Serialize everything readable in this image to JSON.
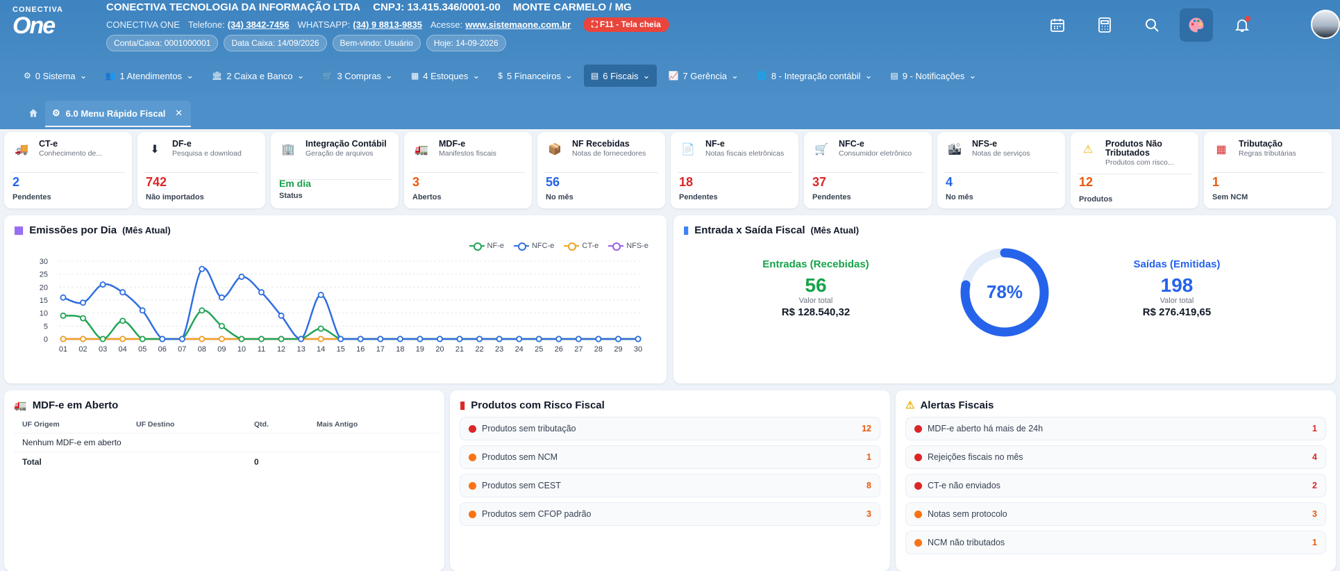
{
  "header": {
    "logo_small": "CONECTIVA",
    "logo_big": "One",
    "company": "CONECTIVA TECNOLOGIA DA INFORMAÇÃO LTDA",
    "cnpj": "CNPJ: 13.415.346/0001-00",
    "city": "MONTE CARMELO / MG",
    "brand": "CONECTIVA ONE",
    "phone_label": "Telefone:",
    "phone": "(34) 3842-7456",
    "whatsapp_label": "WHATSAPP:",
    "whatsapp": "(34) 9 8813-9835",
    "site_label": "Acesse:",
    "site": "www.sistemaone.com.br",
    "fullscreen": "⛶ F11 - Tela cheia",
    "pills": [
      "Conta/Caixa: 0001000001",
      "Data Caixa: 14/09/2026",
      "Bem-vindo: Usuário",
      "Hoje: 14-09-2026"
    ]
  },
  "menu": [
    {
      "icon": "⚙",
      "label": "0 Sistema"
    },
    {
      "icon": "👥",
      "label": "1 Atendimentos"
    },
    {
      "icon": "🏛",
      "label": "2 Caixa e Banco"
    },
    {
      "icon": "🛒",
      "label": "3 Compras"
    },
    {
      "icon": "▦",
      "label": "4 Estoques"
    },
    {
      "icon": "$",
      "label": "5 Financeiros"
    },
    {
      "icon": "▤",
      "label": "6 Fiscais"
    },
    {
      "icon": "📈",
      "label": "7 Gerência"
    },
    {
      "icon": "🌐",
      "label": "8 - Integração contábil"
    },
    {
      "icon": "▤",
      "label": "9 - Notificações"
    }
  ],
  "tab": {
    "label": "6.0 Menu Rápido Fiscal",
    "close": "✕"
  },
  "cards": [
    {
      "icon": "🚚",
      "title": "CT-e",
      "sub": "Conhecimento de...",
      "value": "2",
      "label": "Pendentes",
      "color": "#2563eb"
    },
    {
      "icon": "⬇",
      "title": "DF-e",
      "sub": "Pesquisa e download",
      "value": "742",
      "label": "Não importados",
      "color": "#dc2626"
    },
    {
      "icon": "🏢",
      "title": "Integração Contábil",
      "sub": "Geração de arquivos",
      "value": "Em dia",
      "label": "Status",
      "color": "#16a34a"
    },
    {
      "icon": "🚛",
      "title": "MDF-e",
      "sub": "Manifestos fiscais",
      "value": "3",
      "label": "Abertos",
      "color": "#ea580c"
    },
    {
      "icon": "📦",
      "title": "NF Recebidas",
      "sub": "Notas de fornecedores",
      "value": "56",
      "label": "No mês",
      "color": "#2563eb"
    },
    {
      "icon": "📄",
      "title": "NF-e",
      "sub": "Notas fiscais eletrônicas",
      "value": "18",
      "label": "Pendentes",
      "color": "#dc2626"
    },
    {
      "icon": "🛒",
      "title": "NFC-e",
      "sub": "Consumidor eletrônico",
      "value": "37",
      "label": "Pendentes",
      "color": "#dc2626"
    },
    {
      "icon": "🏙",
      "title": "NFS-e",
      "sub": "Notas de serviços",
      "value": "4",
      "label": "No mês",
      "color": "#2563eb"
    },
    {
      "icon": "⚠",
      "title": "Produtos Não Tributados",
      "sub": "Produtos com risco...",
      "value": "12",
      "label": "Produtos",
      "color": "#ea580c"
    },
    {
      "icon": "▦",
      "title": "Tributação",
      "sub": "Regras tributárias",
      "value": "1",
      "label": "Sem NCM",
      "color": "#ea580c"
    }
  ],
  "emissoes": {
    "title": "Emissões por Dia",
    "title_suffix": "(Mês Atual)"
  },
  "chart_data": {
    "type": "line",
    "title": "Emissões por Dia (Mês Atual)",
    "categories": [
      "01",
      "02",
      "03",
      "04",
      "05",
      "06",
      "07",
      "08",
      "09",
      "10",
      "11",
      "12",
      "13",
      "14",
      "15",
      "16",
      "17",
      "18",
      "19",
      "20",
      "21",
      "22",
      "23",
      "24",
      "25",
      "26",
      "27",
      "28",
      "29",
      "30"
    ],
    "ylim": [
      0,
      30
    ],
    "yticks": [
      0,
      5,
      10,
      15,
      20,
      25,
      30
    ],
    "grid": true,
    "legend": "top-right",
    "series": [
      {
        "name": "NF-e",
        "color": "#22a455",
        "values": [
          9,
          8,
          0,
          7,
          0,
          0,
          0,
          11,
          5,
          0,
          0,
          0,
          0,
          4,
          0,
          0,
          0,
          0,
          0,
          0,
          0,
          0,
          0,
          0,
          0,
          0,
          0,
          0,
          0,
          0
        ]
      },
      {
        "name": "NFC-e",
        "color": "#2f6fe0",
        "values": [
          16,
          14,
          21,
          18,
          11,
          0,
          0,
          27,
          16,
          24,
          18,
          9,
          0,
          17,
          0,
          0,
          0,
          0,
          0,
          0,
          0,
          0,
          0,
          0,
          0,
          0,
          0,
          0,
          0,
          0
        ]
      },
      {
        "name": "CT-e",
        "color": "#f0a321",
        "values": [
          0,
          0,
          0,
          0,
          0,
          0,
          0,
          0,
          0,
          0,
          0,
          0,
          0,
          0,
          0,
          0,
          0,
          0,
          0,
          0,
          0,
          0,
          0,
          0,
          0,
          0,
          0,
          0,
          0,
          0
        ]
      },
      {
        "name": "NFS-e",
        "color": "#9b5de5",
        "values": [
          0,
          0,
          0,
          0,
          0,
          0,
          0,
          0,
          0,
          0,
          0,
          0,
          0,
          0,
          0,
          0,
          0,
          0,
          0,
          0,
          0,
          0,
          0,
          0,
          0,
          0,
          0,
          0,
          0,
          0
        ]
      }
    ]
  },
  "entrada_saida": {
    "title": "Entrada x Saída Fiscal",
    "title_suffix": "(Mês Atual)",
    "entradas_label": "Entradas (Recebidas)",
    "entradas_value": "56",
    "entradas_sub": "Valor total",
    "entradas_total": "R$ 128.540,32",
    "saidas_label": "Saídas (Emitidas)",
    "saidas_value": "198",
    "saidas_sub": "Valor total",
    "saidas_total": "R$ 276.419,65",
    "percent_label": "78%",
    "percent": 78
  },
  "mdfe": {
    "title": "MDF-e em Aberto",
    "headers": [
      "UF Origem",
      "UF Destino",
      "Qtd.",
      "Mais Antigo"
    ],
    "empty": "Nenhum MDF-e em aberto",
    "total_label": "Total",
    "total_value": "0"
  },
  "risco": {
    "title": "Produtos com Risco Fiscal",
    "items": [
      {
        "label": "Produtos sem tributação",
        "value": "12",
        "dot": "#dc2626",
        "color": "#ea580c"
      },
      {
        "label": "Produtos sem NCM",
        "value": "1",
        "dot": "#f97316",
        "color": "#ea580c"
      },
      {
        "label": "Produtos sem CEST",
        "value": "8",
        "dot": "#f97316",
        "color": "#ea580c"
      },
      {
        "label": "Produtos sem CFOP padrão",
        "value": "3",
        "dot": "#f97316",
        "color": "#ea580c"
      }
    ]
  },
  "alertas": {
    "title": "Alertas Fiscais",
    "items": [
      {
        "label": "MDF-e aberto há mais de 24h",
        "value": "1",
        "dot": "#dc2626",
        "color": "#dc2626"
      },
      {
        "label": "Rejeições fiscais no mês",
        "value": "4",
        "dot": "#dc2626",
        "color": "#dc2626"
      },
      {
        "label": "CT-e não enviados",
        "value": "2",
        "dot": "#dc2626",
        "color": "#dc2626"
      },
      {
        "label": "Notas sem protocolo",
        "value": "3",
        "dot": "#f97316",
        "color": "#ea580c"
      },
      {
        "label": "NCM não tributados",
        "value": "1",
        "dot": "#f97316",
        "color": "#ea580c"
      }
    ]
  }
}
